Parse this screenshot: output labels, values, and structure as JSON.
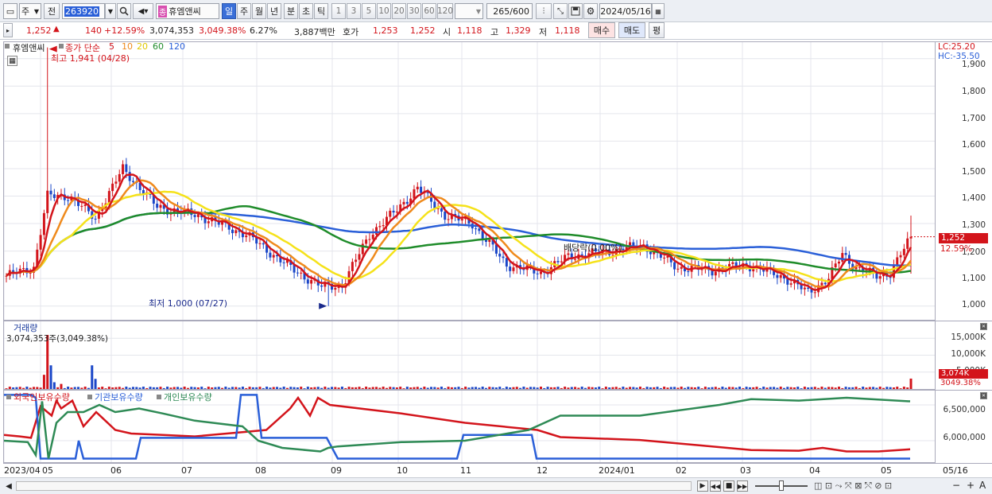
{
  "toolbar": {
    "market_label": "주",
    "prev_label": "전",
    "code_value": "263920",
    "stock_badge": "종",
    "stock_name": "휴엠앤씨",
    "periods": [
      "일",
      "주",
      "월",
      "년",
      "분",
      "초",
      "틱"
    ],
    "active_period": "일",
    "intervals": [
      "1",
      "3",
      "5",
      "10",
      "20",
      "30",
      "60",
      "120"
    ],
    "count_value": "265",
    "count_total": "/600",
    "date_value": "2024/05/16"
  },
  "quote": {
    "price": "1,252",
    "change_arrow": "▲",
    "change": "140",
    "change_pct": "+12.59%",
    "volume": "3,074,353",
    "volume_pct": "3,049.38%",
    "turnover_pct": "6.27%",
    "amount": "3,887백만",
    "hoga_label": "호가",
    "ask": "1,253",
    "bid": "1,252",
    "open_label": "시",
    "open": "1,118",
    "high_label": "고",
    "high": "1,329",
    "low_label": "저",
    "low": "1,118",
    "buy_label": "매수",
    "sell_label": "매도",
    "eval_label": "평"
  },
  "price_panel": {
    "stock_name": "휴엠앤씨",
    "legend_prefix": "종가 단순",
    "ma_periods": [
      "5",
      "10",
      "20",
      "60",
      "120"
    ],
    "ma_colors": [
      "#d3141b",
      "#ef8a1c",
      "#f5e21a",
      "#1f8c2a",
      "#2a5fd8"
    ],
    "high_annotation": "최고 1,941 (04/28)",
    "low_annotation": "최저 1,000 (07/27)",
    "dividend_annotation": "배당락(0.00%)",
    "lc_label": "LC:25.20",
    "hc_label": "HC:-35.50",
    "current_price_tag": "1,252",
    "current_pct_tag": "12.59%",
    "y_ticks": [
      "1,900",
      "1,800",
      "1,700",
      "1,600",
      "1,500",
      "1,400",
      "1,300",
      "1,200",
      "1,100",
      "1,000"
    ]
  },
  "volume_panel": {
    "title": "거래량",
    "value": "3,074,353주(3,049.38%)",
    "y_ticks": [
      "15,000K",
      "10,000K",
      "5,000K"
    ],
    "current_tag": "3,074K",
    "current_pct_tag": "3049.38%"
  },
  "holdings_panel": {
    "legend": [
      "외국인보유수량",
      "기관보유수량",
      "개인보유수량"
    ],
    "legend_colors": [
      "#d3141b",
      "#2a5fd8",
      "#2e8a55"
    ],
    "y_ticks": [
      "6,500,000",
      "6,000,000"
    ]
  },
  "x_axis": {
    "labels": [
      "2023/04",
      "05",
      "06",
      "07",
      "08",
      "09",
      "10",
      "11",
      "12",
      "2024/01",
      "02",
      "03",
      "04",
      "05"
    ],
    "right_label": "05/16"
  },
  "chart_data": {
    "type": "candlestick",
    "x_range": [
      "2023/04",
      "2024/05/16"
    ],
    "price_ylim": [
      950,
      1960
    ],
    "price_high": {
      "value": 1941,
      "date": "04/28"
    },
    "price_low": {
      "value": 1000,
      "date": "07/27"
    },
    "last_close": 1252,
    "close_series_approx": [
      {
        "month": "2023/04",
        "close": 1110
      },
      {
        "month": "05",
        "close": 1380
      },
      {
        "month": "06",
        "close": 1330
      },
      {
        "month": "07",
        "close": 1130
      },
      {
        "month": "08",
        "close": 1300
      },
      {
        "month": "09",
        "close": 1270
      },
      {
        "month": "10",
        "close": 1130
      },
      {
        "month": "11",
        "close": 1190
      },
      {
        "month": "12",
        "close": 1140
      },
      {
        "month": "2024/01",
        "close": 1130
      },
      {
        "month": "02",
        "close": 1110
      },
      {
        "month": "03",
        "close": 1050
      },
      {
        "month": "04",
        "close": 1130
      },
      {
        "month": "05",
        "close": 1252
      }
    ],
    "volume_last": 3074353,
    "holdings_ylim": [
      5700000,
      6700000
    ]
  }
}
